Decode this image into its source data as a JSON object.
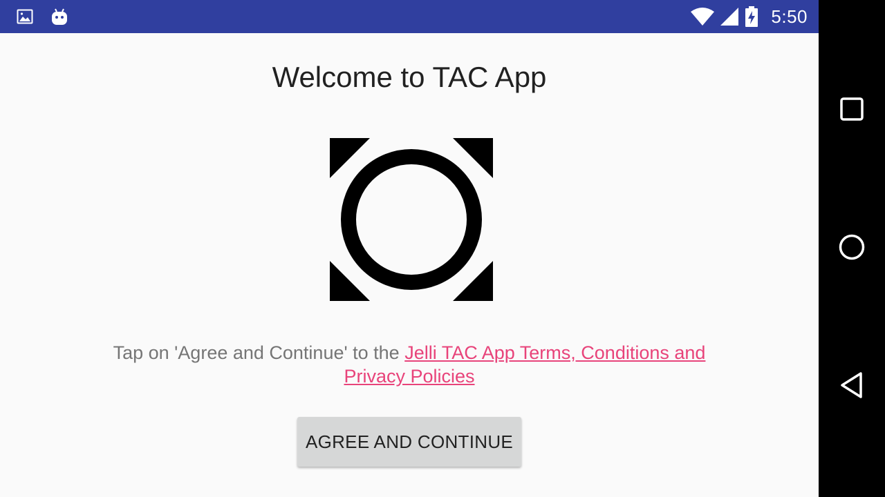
{
  "status_bar": {
    "time": "5:50",
    "icons": [
      "gallery-icon",
      "android-icon",
      "wifi-icon",
      "signal-icon",
      "battery-charging-icon"
    ],
    "background": "#303f9f"
  },
  "app": {
    "title": "Welcome to TAC App",
    "logo_icon": "tac-logo-icon",
    "terms_text": "Tap on 'Agree and Continue' to the ",
    "terms_link": "Jelli TAC App Terms, Conditions and Privacy Policies",
    "agree_button": "AGREE AND CONTINUE",
    "link_color": "#e8437a",
    "background": "#fafafa"
  },
  "nav_bar": {
    "icons": [
      "recents-icon",
      "home-icon",
      "back-icon"
    ]
  }
}
